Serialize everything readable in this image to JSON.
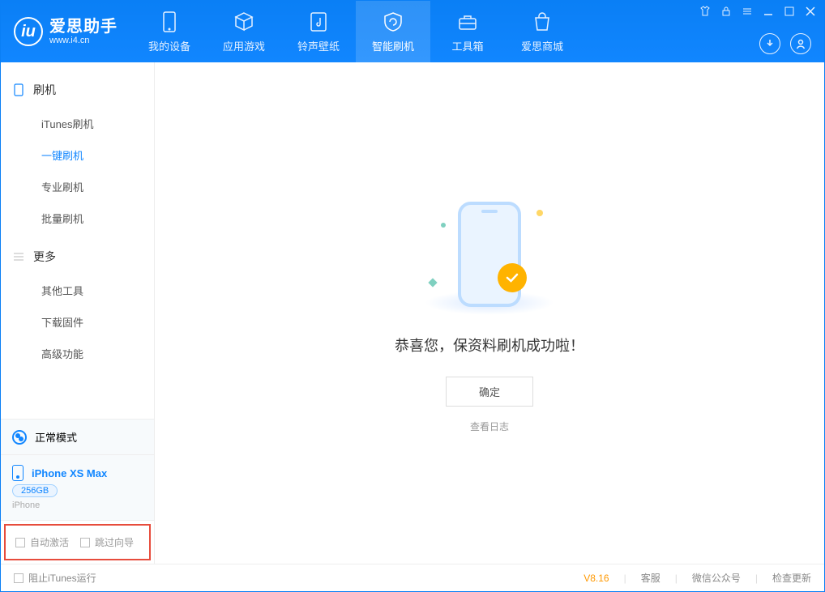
{
  "app": {
    "name": "爱思助手",
    "url": "www.i4.cn"
  },
  "tabs": [
    {
      "label": "我的设备"
    },
    {
      "label": "应用游戏"
    },
    {
      "label": "铃声壁纸"
    },
    {
      "label": "智能刷机"
    },
    {
      "label": "工具箱"
    },
    {
      "label": "爱思商城"
    }
  ],
  "sidebar": {
    "group1_title": "刷机",
    "group1": [
      {
        "label": "iTunes刷机"
      },
      {
        "label": "一键刷机"
      },
      {
        "label": "专业刷机"
      },
      {
        "label": "批量刷机"
      }
    ],
    "group2_title": "更多",
    "group2": [
      {
        "label": "其他工具"
      },
      {
        "label": "下载固件"
      },
      {
        "label": "高级功能"
      }
    ]
  },
  "device": {
    "mode": "正常模式",
    "name": "iPhone XS Max",
    "storage": "256GB",
    "type": "iPhone"
  },
  "options": {
    "auto_activate": "自动激活",
    "skip_guide": "跳过向导"
  },
  "main": {
    "success_text": "恭喜您，保资料刷机成功啦！",
    "ok": "确定",
    "view_log": "查看日志"
  },
  "status": {
    "block_itunes": "阻止iTunes运行",
    "version": "V8.16",
    "support": "客服",
    "wechat": "微信公众号",
    "check_update": "检查更新"
  }
}
